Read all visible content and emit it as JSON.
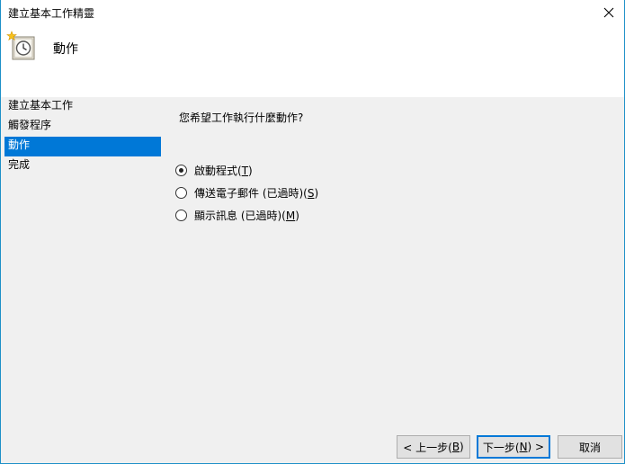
{
  "window": {
    "title": "建立基本工作精靈"
  },
  "header": {
    "title": "動作"
  },
  "nav": {
    "items": [
      {
        "label": "建立基本工作",
        "selected": false
      },
      {
        "label": "觸發程序",
        "selected": false
      },
      {
        "label": "動作",
        "selected": true
      },
      {
        "label": "完成",
        "selected": false
      }
    ]
  },
  "content": {
    "question": "您希望工作執行什麼動作?",
    "options": [
      {
        "label": "啟動程式(",
        "key": "T",
        "suffix": ")",
        "checked": true
      },
      {
        "label": "傳送電子郵件 (已過時)(",
        "key": "S",
        "suffix": ")",
        "checked": false
      },
      {
        "label": "顯示訊息 (已過時)(",
        "key": "M",
        "suffix": ")",
        "checked": false
      }
    ]
  },
  "buttons": {
    "back": {
      "pre": "< 上一步(",
      "key": "B",
      "post": ")"
    },
    "next": {
      "pre": "下一步(",
      "key": "N",
      "post": ") >"
    },
    "cancel": {
      "label": "取消"
    }
  },
  "colors": {
    "accent": "#0078d7",
    "window_border": "#1e90c8",
    "body_bg": "#f0f0f0"
  },
  "icons": {
    "close": "close-icon",
    "header": "task-scheduler-clock-icon"
  }
}
